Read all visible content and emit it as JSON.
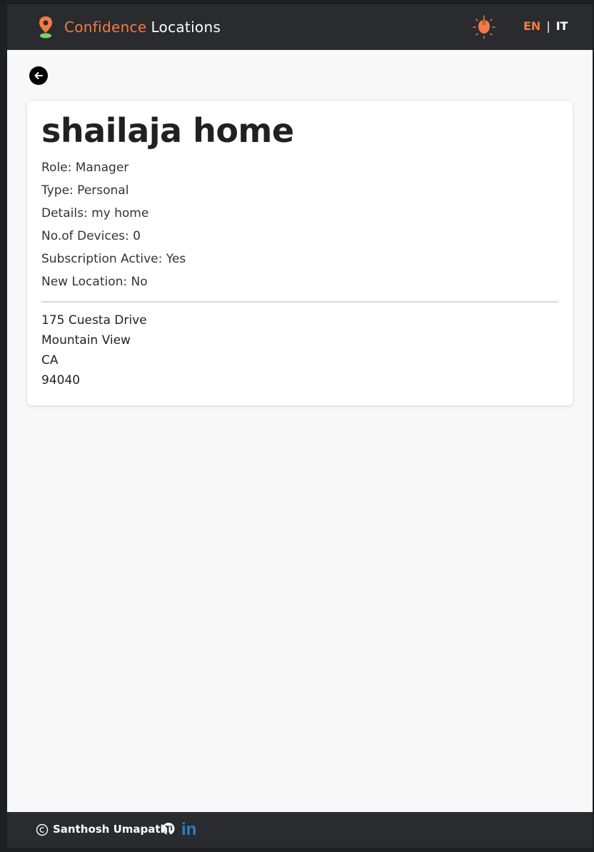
{
  "brand": {
    "name_part1": "Confidence",
    "name_part2": "Locations",
    "accent": "#f47b45",
    "icon": "map-pin-icon"
  },
  "nav": {
    "theme_icon": "lightbulb-icon",
    "lang_en": "EN",
    "lang_sep": "|",
    "lang_it": "IT"
  },
  "back_icon": "arrow-left-icon",
  "location": {
    "name": "shailaja home",
    "role": "Role: Manager",
    "type": "Type: Personal",
    "details": "Details: my home",
    "devices": "No.of Devices: 0",
    "subscription": "Subscription Active: Yes",
    "new_location": "New Location: No",
    "address": {
      "street": "175 Cuesta Drive",
      "city": "Mountain View",
      "state": "CA",
      "zip": "94040"
    }
  },
  "footer": {
    "copyright_icon": "copyright-icon",
    "author": "Santhosh Umapathi",
    "github_icon": "github-icon",
    "linkedin_icon": "linkedin-icon",
    "linkedin_text": "in"
  }
}
